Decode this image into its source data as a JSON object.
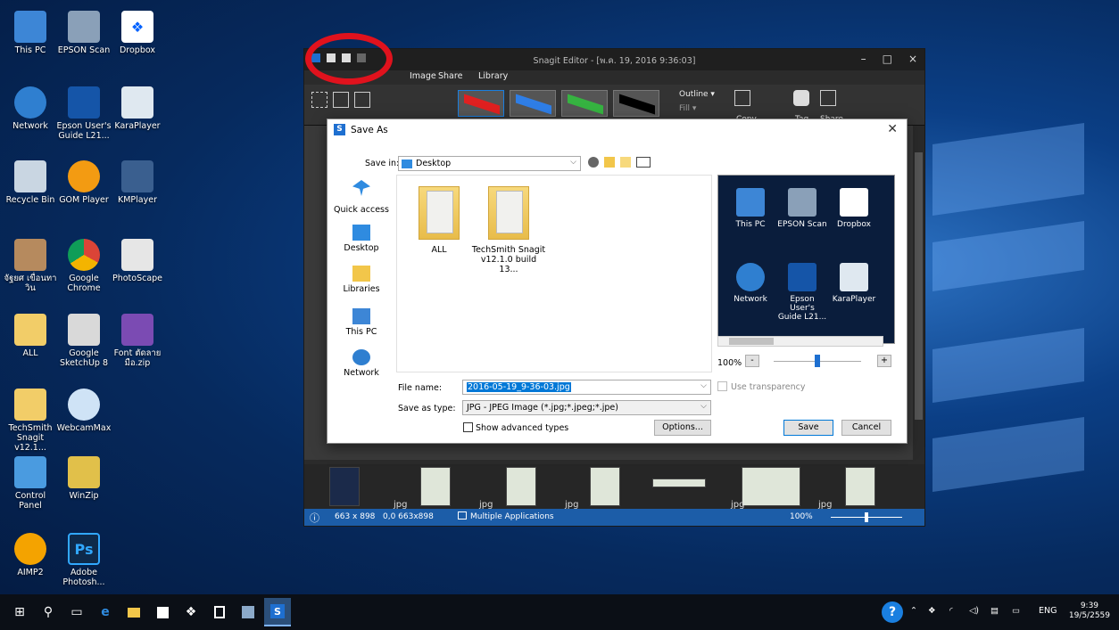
{
  "desktop": {
    "icons": [
      {
        "label": "This PC",
        "icon": "this-pc-icon"
      },
      {
        "label": "EPSON Scan",
        "icon": "scanner-icon"
      },
      {
        "label": "Dropbox",
        "icon": "dropbox-icon"
      },
      {
        "label": "Network",
        "icon": "network-icon"
      },
      {
        "label": "Epson User's Guide L21...",
        "icon": "guide-icon"
      },
      {
        "label": "KaraPlayer",
        "icon": "karaplayer-icon"
      },
      {
        "label": "Recycle Bin",
        "icon": "recycle-bin-icon"
      },
      {
        "label": "GOM Player",
        "icon": "gom-player-icon"
      },
      {
        "label": "KMPlayer",
        "icon": "kmplayer-icon"
      },
      {
        "label": "จัฐยศ เขื่อนทาวิน",
        "icon": "user-folder-icon"
      },
      {
        "label": "Google Chrome",
        "icon": "chrome-icon"
      },
      {
        "label": "PhotoScape",
        "icon": "photoscape-icon"
      },
      {
        "label": "ALL",
        "icon": "folder-icon"
      },
      {
        "label": "Google SketchUp 8",
        "icon": "sketchup-icon"
      },
      {
        "label": "Font ตัดลาย มือ.zip",
        "icon": "zip-icon"
      },
      {
        "label": "TechSmith Snagit v12.1...",
        "icon": "folder-icon"
      },
      {
        "label": "WebcamMax",
        "icon": "webcam-icon"
      },
      {
        "label": "Control Panel",
        "icon": "control-panel-icon"
      },
      {
        "label": "WinZip",
        "icon": "winzip-icon"
      },
      {
        "label": "AIMP2",
        "icon": "aimp-icon"
      },
      {
        "label": "Adobe Photosh...",
        "icon": "photoshop-icon"
      }
    ]
  },
  "snagit": {
    "title": "Snagit Editor - [พ.ค. 19, 2016 9:36:03]",
    "tabs": [
      "Image",
      "Share",
      "Library"
    ],
    "ribbon": {
      "outline": "Outline ▾",
      "fill": "Fill ▾",
      "copy": "Copy",
      "tag": "Tag",
      "share": "Share"
    },
    "tray_tags": [
      "jpg",
      "jpg",
      "jpg",
      "jpg",
      "jpg"
    ],
    "status": {
      "size": "663 x 898",
      "pos": "0,0 663x898",
      "apps": "Multiple Applications",
      "zoom": "100%"
    }
  },
  "dialog": {
    "title": "Save As",
    "save_in_label": "Save in:",
    "save_in_value": "Desktop",
    "places": [
      "Quick access",
      "Desktop",
      "Libraries",
      "This PC",
      "Network"
    ],
    "files": [
      {
        "name": "ALL"
      },
      {
        "name": "TechSmith Snagit v12.1.0 build 13..."
      }
    ],
    "preview_items": [
      {
        "label": "This PC"
      },
      {
        "label": "EPSON Scan"
      },
      {
        "label": "Dropbox"
      },
      {
        "label": "Network"
      },
      {
        "label": "Epson User's Guide L21..."
      },
      {
        "label": "KaraPlayer"
      }
    ],
    "zoom": "100%",
    "file_name_label": "File name:",
    "file_name_value": "2016-05-19_9-36-03.jpg",
    "type_label": "Save as type:",
    "type_value": "JPG - JPEG Image (*.jpg;*.jpeg;*.jpe)",
    "use_transparency": "Use transparency",
    "show_advanced": "Show advanced types",
    "options_btn": "Options...",
    "save_btn": "Save",
    "cancel_btn": "Cancel"
  },
  "taskbar": {
    "lang": "ENG",
    "time": "9:39",
    "date": "19/5/2559"
  },
  "colors": {
    "accent": "#1c5da8",
    "annotation": "#e0121d"
  }
}
